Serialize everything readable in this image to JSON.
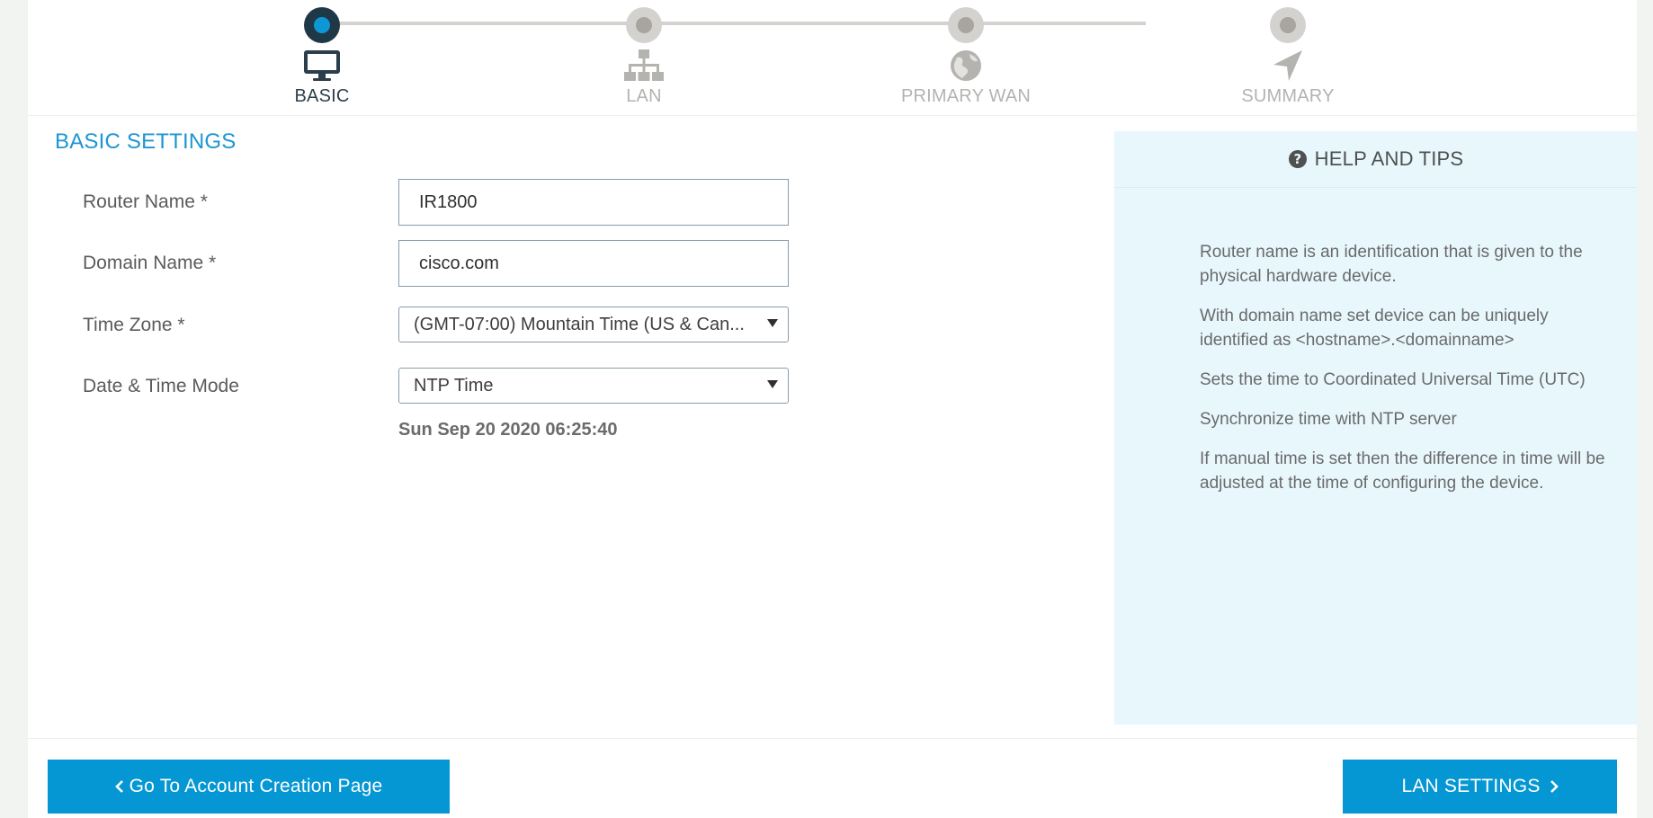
{
  "stepper": {
    "steps": [
      {
        "label": "BASIC",
        "icon": "monitor-icon",
        "active": true
      },
      {
        "label": "LAN",
        "icon": "network-icon",
        "active": false
      },
      {
        "label": "PRIMARY WAN",
        "icon": "globe-icon",
        "active": false
      },
      {
        "label": "SUMMARY",
        "icon": "navigation-arrow-icon",
        "active": false
      }
    ]
  },
  "form": {
    "title": "BASIC SETTINGS",
    "router_name": {
      "label": "Router Name *",
      "value": "IR1800"
    },
    "domain_name": {
      "label": "Domain Name *",
      "value": "cisco.com"
    },
    "time_zone": {
      "label": "Time Zone *",
      "value": "(GMT-07:00) Mountain Time (US & Can..."
    },
    "date_time_mode": {
      "label": "Date & Time Mode",
      "value": "NTP Time"
    },
    "current_datetime": "Sun Sep 20 2020 06:25:40"
  },
  "help": {
    "title": "HELP AND TIPS",
    "tips": [
      "Router name is an identification that is given to the physical hardware device.",
      "With domain name set device can be uniquely identified as <hostname>.<domainname>",
      "Sets the time to Coordinated Universal Time (UTC)",
      "Synchronize time with NTP server",
      "If manual time is set then the difference in time will be adjusted at the time of configuring the device."
    ]
  },
  "footer": {
    "back_label": "Go To Account Creation Page",
    "next_label": "LAN SETTINGS"
  },
  "colors": {
    "accent": "#0597d3",
    "active_step_dot": "#0d97d5",
    "help_bg": "#e8f7fc"
  }
}
